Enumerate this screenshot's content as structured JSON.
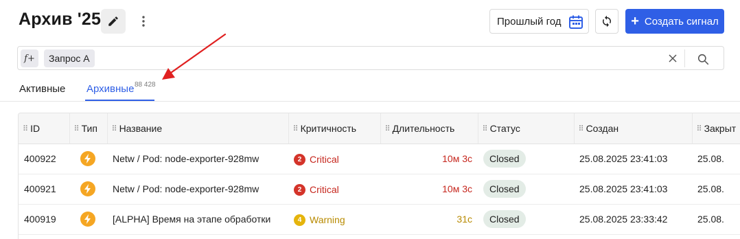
{
  "header": {
    "title": "Архив '25",
    "period_label": "Прошлый год",
    "create_label": "Создать сигнал"
  },
  "query": {
    "fx_label": "f+",
    "chip_label": "Запрос A"
  },
  "tabs": [
    {
      "label": "Активные",
      "active": false
    },
    {
      "label": "Архивные",
      "active": true,
      "count": "88 428"
    }
  ],
  "table": {
    "columns": [
      "ID",
      "Тип",
      "Название",
      "Критичность",
      "Длительность",
      "Статус",
      "Создан",
      "Закрыт"
    ],
    "rows": [
      {
        "id": "400922",
        "name": "Netw / Pod: node-exporter-928mw",
        "sev_num": "2",
        "sev_label": "Critical",
        "sev_color": "#d4342a",
        "duration": "10м 3с",
        "status": "Closed",
        "created": "25.08.2025 23:41:03",
        "closed": "25.08."
      },
      {
        "id": "400921",
        "name": "Netw / Pod: node-exporter-928mw",
        "sev_num": "2",
        "sev_label": "Critical",
        "sev_color": "#d4342a",
        "duration": "10м 3с",
        "status": "Closed",
        "created": "25.08.2025 23:41:03",
        "closed": "25.08."
      },
      {
        "id": "400919",
        "name": "[ALPHA] Время на этапе обработки",
        "sev_num": "4",
        "sev_label": "Warning",
        "sev_color": "#e5b40c",
        "duration": "31с",
        "status": "Closed",
        "created": "25.08.2025 23:33:42",
        "closed": "25.08."
      }
    ]
  },
  "colors": {
    "accent": "#2f5fe6",
    "critical": "#d4342a",
    "warning": "#e5b40c",
    "critical_text": "#c6261d",
    "warning_text": "#b88a00",
    "type_icon": "#f5a623",
    "annotation_arrow": "#e02020"
  },
  "icons": {
    "edit": "pencil-icon",
    "more": "more-vertical-icon",
    "period": "calendar-icon",
    "refresh": "refresh-icon",
    "create": "plus-icon",
    "clear": "close-icon",
    "search": "search-icon",
    "type": "lightning-icon",
    "column_grip": "drag-handle-icon"
  }
}
